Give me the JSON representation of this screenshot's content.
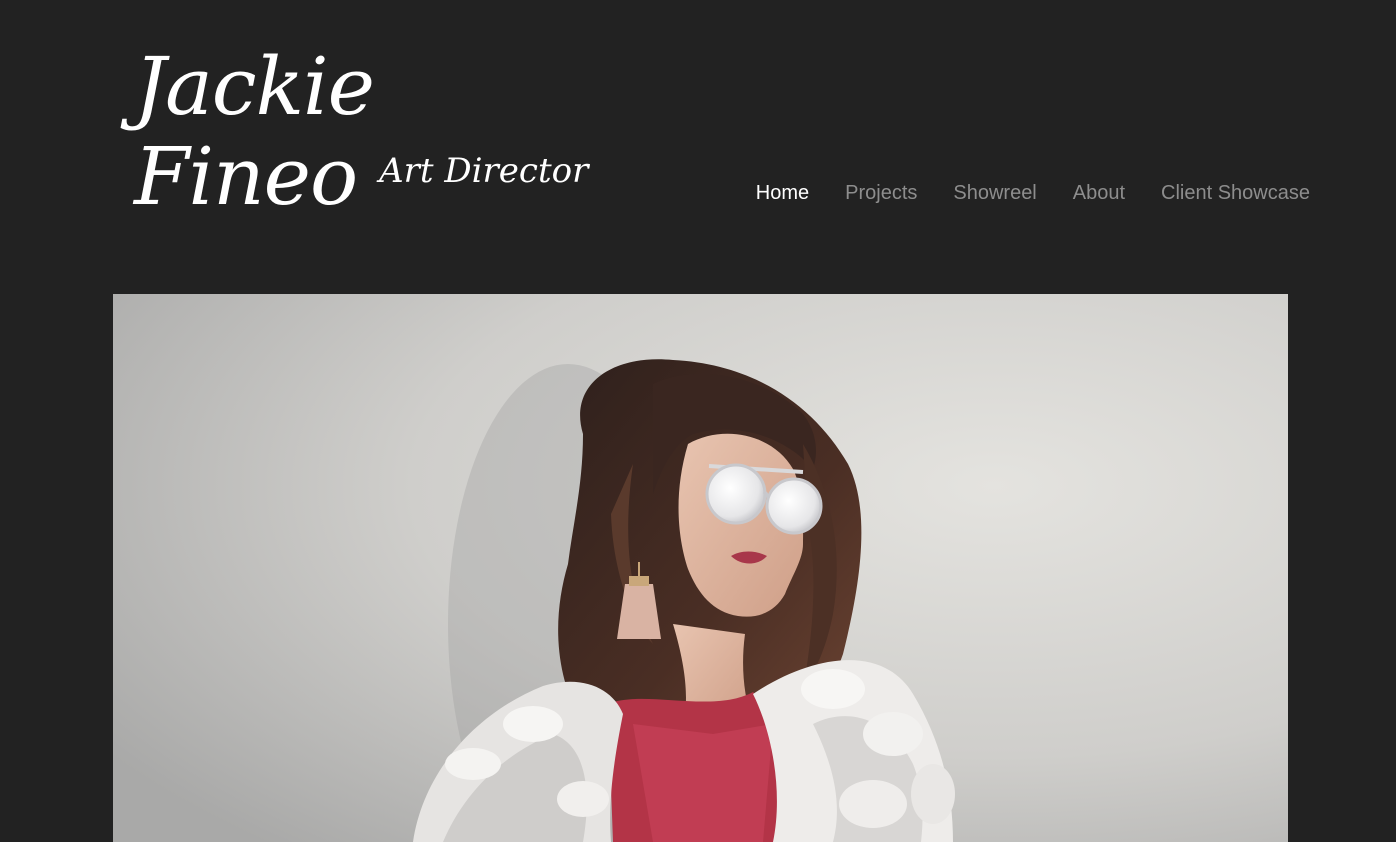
{
  "header": {
    "name_line1": "Jackie",
    "name_line2": "Fineo",
    "title": "Art Director"
  },
  "nav": {
    "items": [
      {
        "label": "Home",
        "active": true
      },
      {
        "label": "Projects",
        "active": false
      },
      {
        "label": "Showreel",
        "active": false
      },
      {
        "label": "About",
        "active": false
      },
      {
        "label": "Client Showcase",
        "active": false
      }
    ]
  },
  "colors": {
    "background": "#222222",
    "nav_active": "#ffffff",
    "nav_inactive": "#8d8d8d"
  }
}
